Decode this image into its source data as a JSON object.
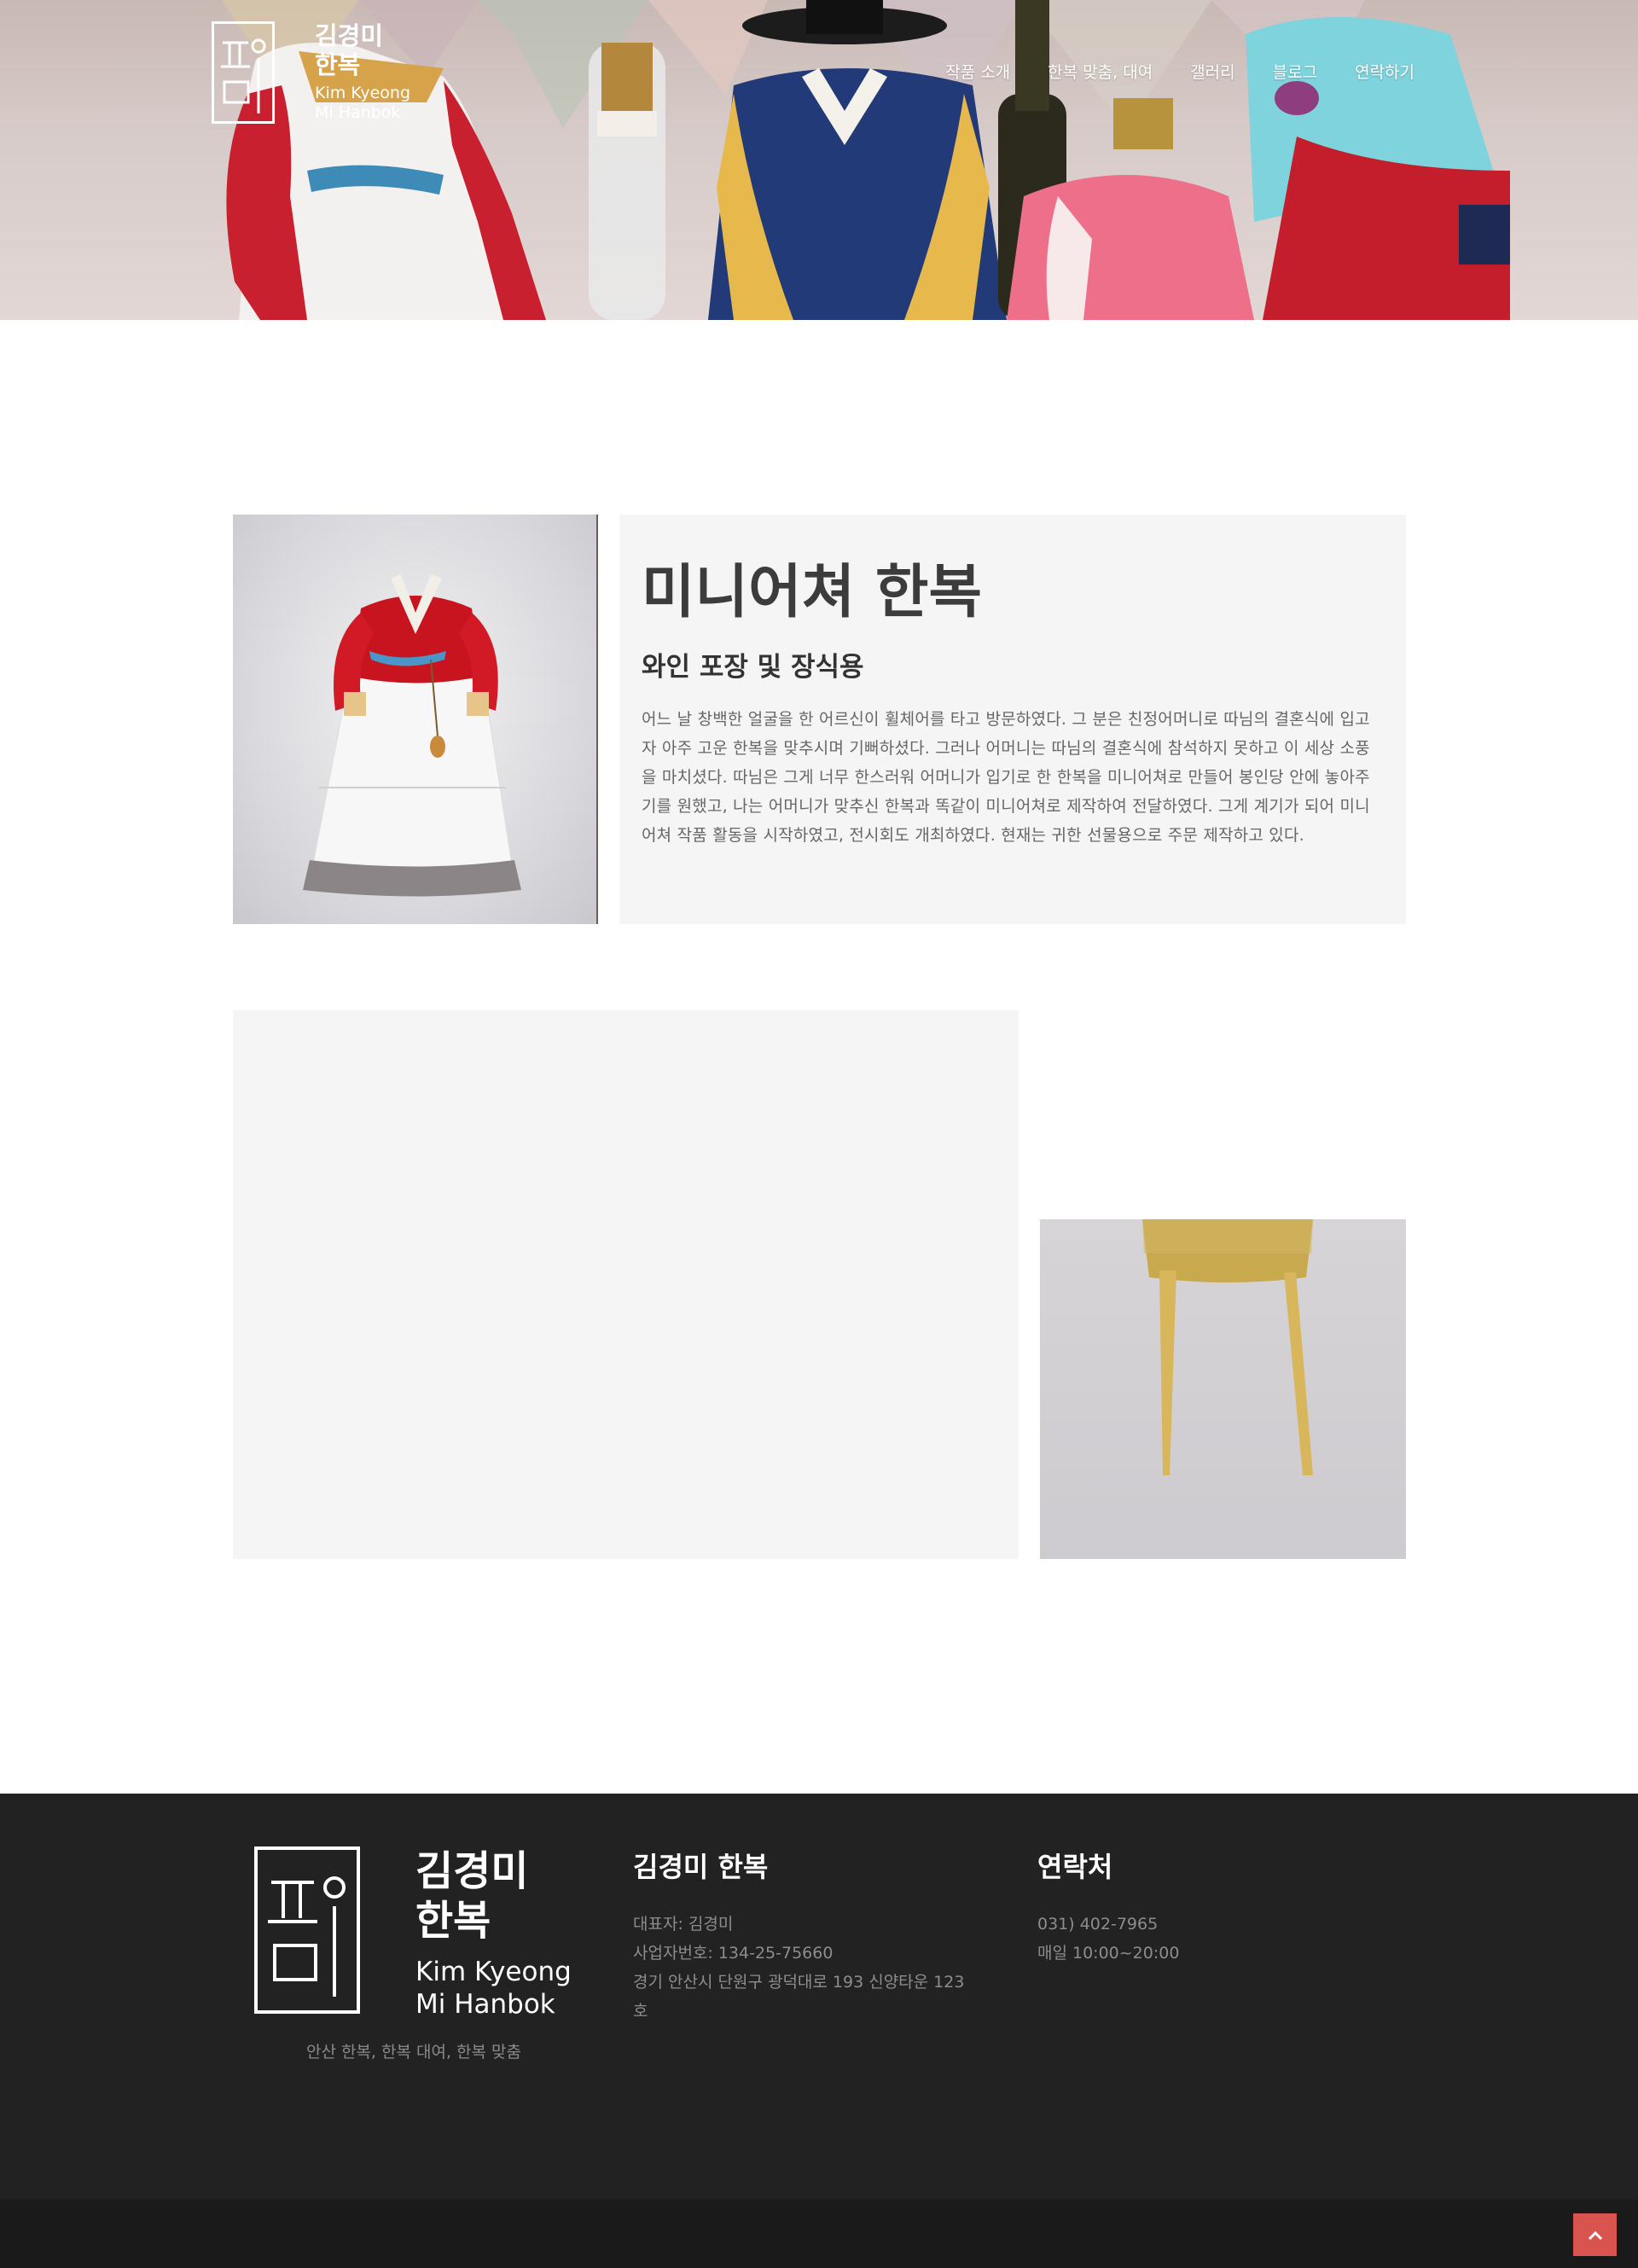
{
  "header": {
    "logo_ko": "김경미\n한복",
    "logo_en": "Kim Kyeong\nMi Hanbok",
    "nav": [
      {
        "label": "작품 소개"
      },
      {
        "label": "한복 맞춤, 대여"
      },
      {
        "label": "갤러리"
      },
      {
        "label": "블로그"
      },
      {
        "label": "연락하기"
      }
    ]
  },
  "feature": {
    "title": "미니어쳐 한복",
    "subtitle": "와인 포장 및 장식용",
    "body": "어느 날 창백한 얼굴을 한 어르신이 휠체어를 타고 방문하였다. 그 분은 친정어머니로 따님의 결혼식에 입고자 아주 고운 한복을 맞추시며 기뻐하셨다. 그러나 어머니는 따님의 결혼식에 참석하지 못하고 이 세상 소풍을 마치셨다. 따님은 그게 너무 한스러워 어머니가 입기로 한 한복을 미니어쳐로 만들어 봉인당 안에 놓아주기를 원했고, 나는 어머니가 맞추신 한복과 똑같이 미니어쳐로 제작하여 전달하였다. 그게 계기가 되어 미니어쳐 작품 활동을 시작하였고, 전시회도 개최하였다. 현재는 귀한 선물용으로 주문 제작하고 있다."
  },
  "footer": {
    "logo_ko": "김경미\n한복",
    "logo_en": "Kim Kyeong\nMi Hanbok",
    "tagline": "안산 한복, 한복 대여, 한복 맞춤",
    "company": {
      "heading": "김경미 한복",
      "lines": [
        "대표자: 김경미",
        "사업자번호: 134-25-75660",
        "경기 안산시 단원구 광덕대로 193 신양타운 123",
        "호"
      ]
    },
    "contact": {
      "heading": "연락처",
      "lines": [
        "031) 402-7965",
        "매일 10:00~20:00"
      ]
    }
  },
  "back_to_top": {
    "icon": "chevron-up-icon",
    "glyph": "︿"
  },
  "colors": {
    "footer_bg": "#222222",
    "bottom_bar": "#1a1a1a",
    "accent": "#d9534f",
    "panel": "#f5f5f5"
  }
}
